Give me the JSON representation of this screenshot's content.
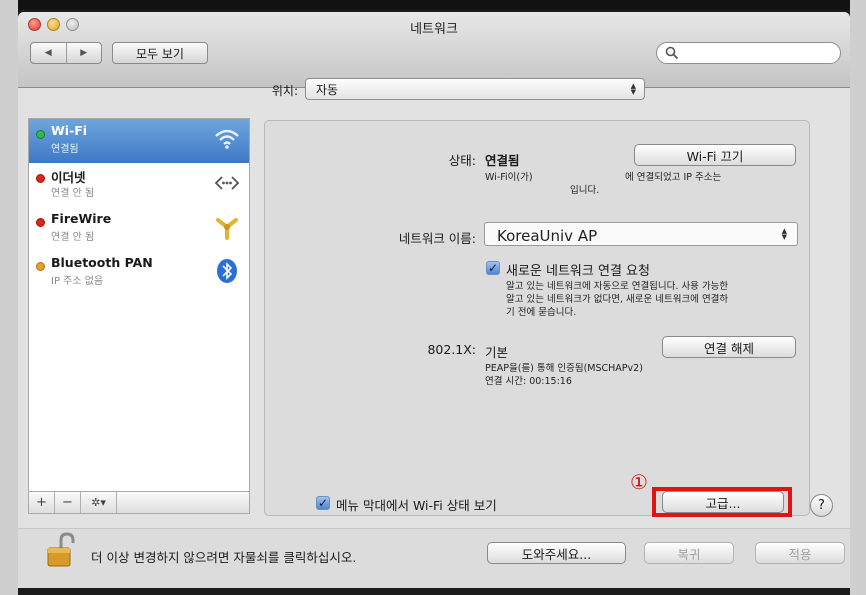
{
  "window": {
    "title": "네트워크"
  },
  "toolbar": {
    "back_icon": "◀",
    "forward_icon": "▶",
    "show_all_label": "모두 보기",
    "search_placeholder": ""
  },
  "location": {
    "label": "위치:",
    "value": "자동"
  },
  "sidebar": {
    "services": [
      {
        "name": "Wi-Fi",
        "status": "연결됨",
        "dot_color": "#35b54a",
        "icon": "wifi-icon"
      },
      {
        "name": "이더넷",
        "status": "연결 안 됨",
        "dot_color": "#d7281e",
        "icon": "ethernet-icon"
      },
      {
        "name": "FireWire",
        "status": "연결 안 됨",
        "dot_color": "#d7281e",
        "icon": "firewire-icon"
      },
      {
        "name": "Bluetooth PAN",
        "status": "IP 주소 없음",
        "dot_color": "#e6a12a",
        "icon": "bluetooth-icon"
      }
    ],
    "add_label": "+",
    "remove_label": "−",
    "gear_label": "✲▾"
  },
  "detail": {
    "status_label": "상태:",
    "status_value": "연결됨",
    "wifi_off_button": "Wi-Fi 끄기",
    "status_desc_line1": "Wi-Fi이(가)",
    "status_desc_line1b": "에 연결되었고 IP 주소는",
    "status_desc_line2": "입니다.",
    "network_name_label": "네트워크 이름:",
    "network_name_value": "KoreaUniv AP",
    "ask_join_label": "새로운 네트워크 연결 요청",
    "ask_join_desc": [
      "알고 있는 네트워크에 자동으로 연결됩니다. 사용 가능한",
      "알고 있는 네트워크가 없다면, 새로운 네트워크에 연결하",
      "기 전에 묻습니다."
    ],
    "dot1x_label": "802.1X:",
    "dot1x_value": "기본",
    "disconnect_button": "연결 해제",
    "auth_line1": "PEAP을(를) 통해 인증됨(MSCHAPv2)",
    "auth_line2": "연결 시간: 00:15:16",
    "show_status_label": "메뉴 막대에서 Wi-Fi 상태 보기",
    "advanced_button": "고급...",
    "help_label": "?"
  },
  "annotation": {
    "number": "①",
    "color": "#e01414"
  },
  "footer": {
    "lock_text": "더 이상 변경하지 않으려면 자물쇠를 클릭하십시오.",
    "assist_button": "도와주세요...",
    "revert_button": "복귀",
    "apply_button": "적용"
  }
}
